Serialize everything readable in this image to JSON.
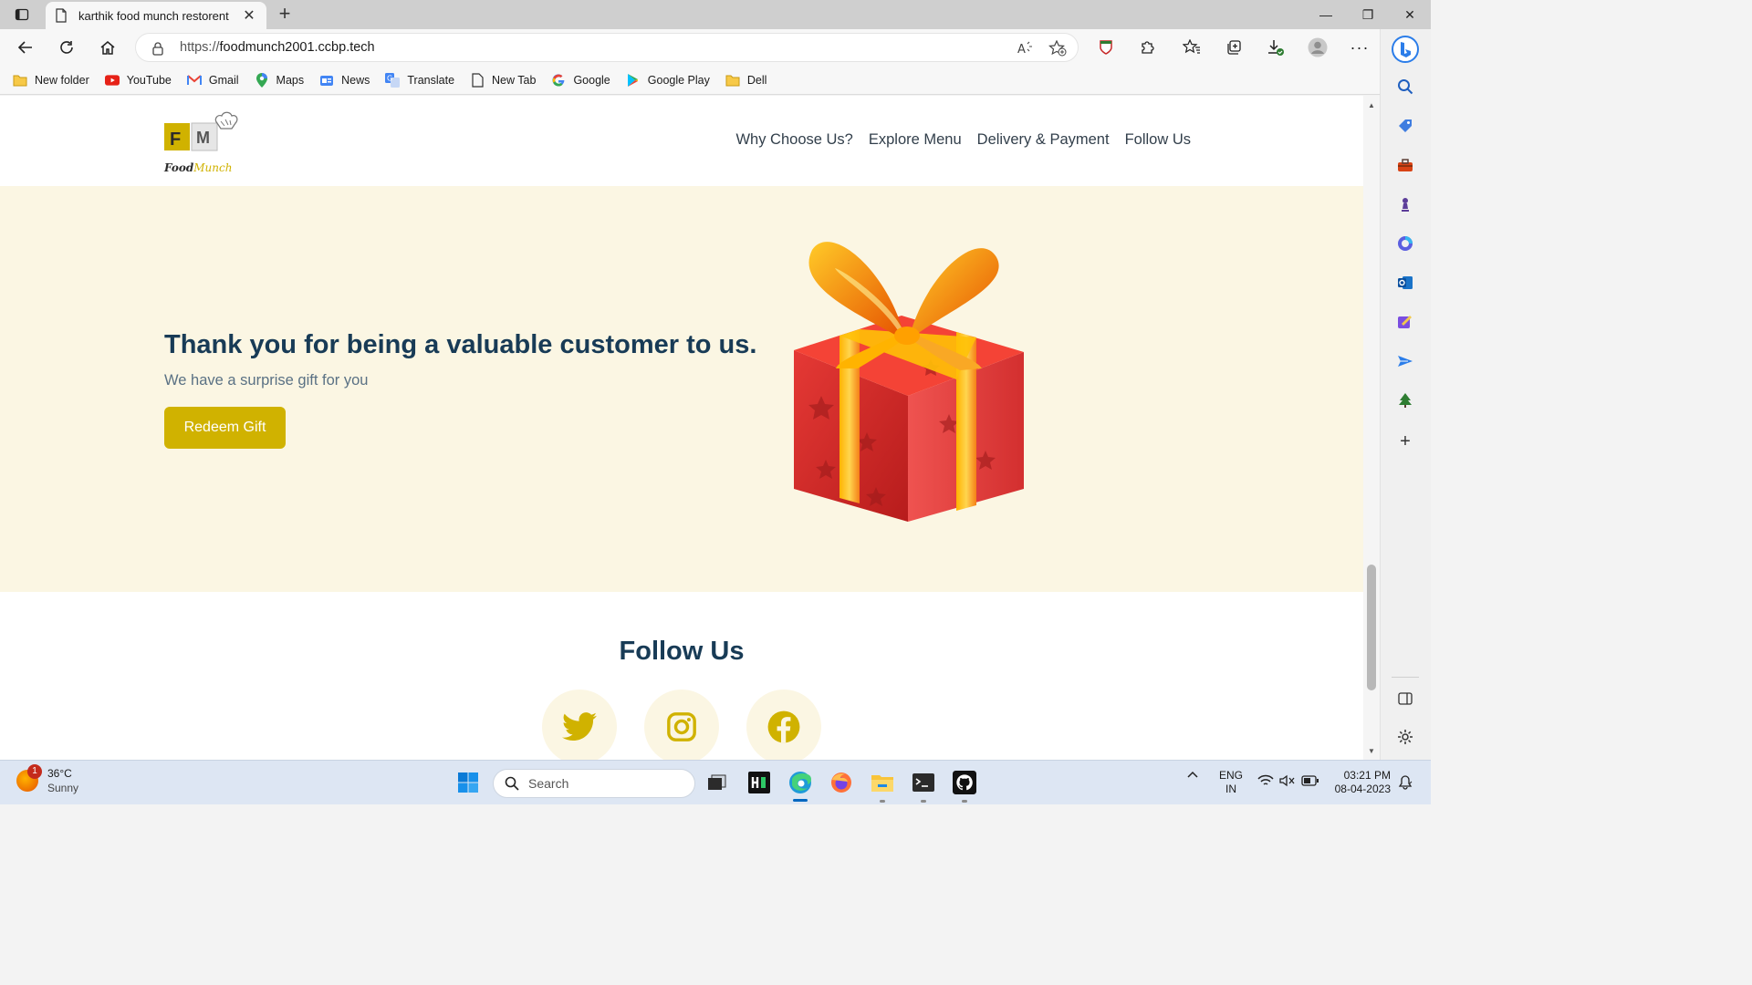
{
  "browser": {
    "tab_title": "karthik food munch restorent",
    "url_protocol": "https://",
    "url_host": "foodmunch2001.ccbp.tech"
  },
  "bookmarks": [
    {
      "label": "New folder",
      "icon": "folder-icon"
    },
    {
      "label": "YouTube",
      "icon": "youtube-icon"
    },
    {
      "label": "Gmail",
      "icon": "gmail-icon"
    },
    {
      "label": "Maps",
      "icon": "maps-icon"
    },
    {
      "label": "News",
      "icon": "news-icon"
    },
    {
      "label": "Translate",
      "icon": "translate-icon"
    },
    {
      "label": "New Tab",
      "icon": "page-icon"
    },
    {
      "label": "Google",
      "icon": "google-icon"
    },
    {
      "label": "Google Play",
      "icon": "google-play-icon"
    },
    {
      "label": "Dell",
      "icon": "folder-icon"
    }
  ],
  "site": {
    "logo_text_a": "Food",
    "logo_text_b": "Munch",
    "logo_letters": [
      "F",
      "M"
    ],
    "nav": [
      "Why Choose Us?",
      "Explore Menu",
      "Delivery & Payment",
      "Follow Us"
    ],
    "gift": {
      "heading": "Thank you for being a valuable customer to us.",
      "subtext": "We have a surprise gift for you",
      "button": "Redeem Gift"
    },
    "follow_title": "Follow Us",
    "social": [
      "twitter-icon",
      "instagram-icon",
      "facebook-icon"
    ]
  },
  "taskbar": {
    "temperature": "36°C",
    "condition": "Sunny",
    "weather_badge": "1",
    "search_placeholder": "Search",
    "lang_line1": "ENG",
    "lang_line2": "IN",
    "time": "03:21 PM",
    "date": "08-04-2023"
  },
  "colors": {
    "brand_yellow": "#d0b200",
    "heading_navy": "#183b56",
    "section_cream": "#fbf6e3"
  }
}
